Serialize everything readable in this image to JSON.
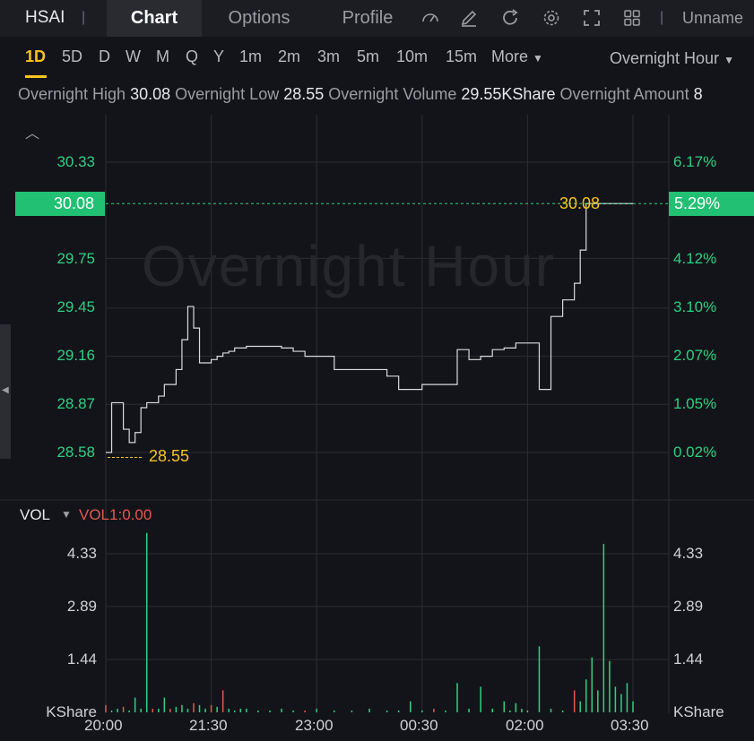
{
  "header": {
    "ticker": "HSAI",
    "tabs": [
      {
        "label": "Chart",
        "active": true
      },
      {
        "label": "Options",
        "active": false
      },
      {
        "label": "Profile",
        "active": false
      }
    ],
    "tools": [
      "speedometer-icon",
      "pencil-icon",
      "refresh-icon",
      "gear-icon",
      "fullscreen-icon",
      "grid-icon"
    ],
    "user": "Unname"
  },
  "timeframes": {
    "items": [
      "1D",
      "5D",
      "D",
      "W",
      "M",
      "Q",
      "Y",
      "1m",
      "2m",
      "3m",
      "5m",
      "10m",
      "15m"
    ],
    "active": "1D",
    "more_label": "More",
    "session_label": "Overnight Hour"
  },
  "info": {
    "high_label": "Overnight High",
    "high_value": "30.08",
    "low_label": "Overnight Low",
    "low_value": "28.55",
    "volume_label": "Overnight Volume",
    "volume_value": "29.55KShare",
    "amount_label": "Overnight Amount",
    "amount_value": "8"
  },
  "price_axis": {
    "left_ticks": [
      "30.33",
      "29.75",
      "29.45",
      "29.16",
      "28.87",
      "28.58"
    ],
    "right_ticks": [
      "6.17%",
      "4.12%",
      "3.10%",
      "2.07%",
      "1.05%",
      "0.02%"
    ],
    "current_price": "30.08",
    "current_pct": "5.29%",
    "high_marker": "30.08",
    "low_marker": "28.55"
  },
  "watermark": "Overnight Hour",
  "volume_panel": {
    "title": "VOL",
    "indicator": "VOL1:0.00",
    "ticks": [
      "4.33",
      "2.89",
      "1.44"
    ],
    "unit": "KShare"
  },
  "x_axis": [
    "20:00",
    "21:30",
    "23:00",
    "00:30",
    "02:00",
    "03:30"
  ],
  "colors": {
    "up": "#2fcf84",
    "down": "#e2584f",
    "accent": "#f5c518",
    "line": "#d9dadd"
  },
  "chart_data": [
    {
      "type": "line",
      "title": "",
      "xlabel": "",
      "ylabel": "",
      "ylim": [
        28.45,
        30.45
      ],
      "x": [
        "20:00",
        "20:05",
        "20:10",
        "20:15",
        "20:20",
        "20:25",
        "20:30",
        "20:35",
        "20:40",
        "20:45",
        "20:50",
        "20:55",
        "21:00",
        "21:05",
        "21:10",
        "21:15",
        "21:20",
        "21:25",
        "21:30",
        "21:35",
        "21:40",
        "21:45",
        "21:50",
        "21:55",
        "22:00",
        "22:10",
        "22:20",
        "22:30",
        "22:40",
        "22:50",
        "23:00",
        "23:15",
        "23:30",
        "23:45",
        "00:00",
        "00:10",
        "00:20",
        "00:30",
        "00:40",
        "00:50",
        "01:00",
        "01:10",
        "01:20",
        "01:30",
        "01:40",
        "01:45",
        "01:50",
        "01:55",
        "02:00",
        "02:10",
        "02:20",
        "02:30",
        "02:40",
        "02:45",
        "02:50",
        "02:55",
        "03:00",
        "03:05",
        "03:10",
        "03:15",
        "03:20",
        "03:25",
        "03:30"
      ],
      "series": [
        {
          "values": [
            28.58,
            28.88,
            28.88,
            28.72,
            28.64,
            28.7,
            28.85,
            28.88,
            28.88,
            28.92,
            28.99,
            28.99,
            29.08,
            29.26,
            29.46,
            29.33,
            29.12,
            29.12,
            29.14,
            29.16,
            29.18,
            29.19,
            29.21,
            29.21,
            29.22,
            29.22,
            29.22,
            29.21,
            29.19,
            29.16,
            29.16,
            29.08,
            29.08,
            29.08,
            29.04,
            28.96,
            28.96,
            28.99,
            28.99,
            28.99,
            29.2,
            29.14,
            29.16,
            29.2,
            29.21,
            29.21,
            29.24,
            29.24,
            29.24,
            28.96,
            29.4,
            29.5,
            29.6,
            29.8,
            30.08,
            30.08,
            30.08,
            30.08,
            30.08,
            30.08,
            30.08,
            30.08,
            30.08
          ]
        }
      ]
    },
    {
      "type": "bar",
      "title": "",
      "ylabel": "",
      "ylim": [
        0,
        5.0
      ],
      "x": [
        "20:00",
        "20:05",
        "20:10",
        "20:15",
        "20:20",
        "20:25",
        "20:30",
        "20:35",
        "20:40",
        "20:45",
        "20:50",
        "20:55",
        "21:00",
        "21:05",
        "21:10",
        "21:15",
        "21:20",
        "21:25",
        "21:30",
        "21:35",
        "21:40",
        "21:45",
        "21:50",
        "21:55",
        "22:00",
        "22:10",
        "22:20",
        "22:30",
        "22:40",
        "22:50",
        "23:00",
        "23:15",
        "23:30",
        "23:45",
        "00:00",
        "00:10",
        "00:20",
        "00:30",
        "00:40",
        "00:50",
        "01:00",
        "01:10",
        "01:20",
        "01:30",
        "01:40",
        "01:45",
        "01:50",
        "01:55",
        "02:00",
        "02:10",
        "02:20",
        "02:30",
        "02:40",
        "02:45",
        "02:50",
        "02:55",
        "03:00",
        "03:05",
        "03:10",
        "03:15",
        "03:20",
        "03:25",
        "03:30"
      ],
      "values": [
        0.2,
        0.05,
        0.1,
        0.15,
        0.05,
        0.4,
        0.1,
        4.9,
        0.1,
        0.1,
        0.4,
        0.1,
        0.15,
        0.2,
        0.1,
        0.25,
        0.2,
        0.1,
        0.2,
        0.15,
        0.6,
        0.1,
        0.05,
        0.1,
        0.1,
        0.05,
        0.05,
        0.1,
        0.05,
        0.05,
        0.1,
        0.05,
        0.05,
        0.1,
        0.05,
        0.05,
        0.3,
        0.05,
        0.1,
        0.05,
        0.8,
        0.1,
        0.7,
        0.1,
        0.3,
        0.05,
        0.25,
        0.1,
        0.05,
        1.8,
        0.1,
        0.05,
        0.6,
        0.3,
        0.9,
        1.5,
        0.6,
        4.6,
        1.4,
        0.7,
        0.5,
        0.8,
        0.3
      ],
      "directions": [
        "d",
        "u",
        "u",
        "d",
        "u",
        "u",
        "u",
        "u",
        "d",
        "u",
        "u",
        "d",
        "u",
        "u",
        "u",
        "d",
        "u",
        "u",
        "d",
        "u",
        "d",
        "u",
        "u",
        "u",
        "u",
        "u",
        "u",
        "u",
        "u",
        "d",
        "u",
        "u",
        "u",
        "u",
        "u",
        "u",
        "u",
        "u",
        "d",
        "u",
        "u",
        "u",
        "u",
        "u",
        "u",
        "u",
        "u",
        "u",
        "u",
        "u",
        "u",
        "u",
        "d",
        "u",
        "u",
        "u",
        "u",
        "u",
        "u",
        "u",
        "u",
        "u",
        "u"
      ]
    }
  ]
}
